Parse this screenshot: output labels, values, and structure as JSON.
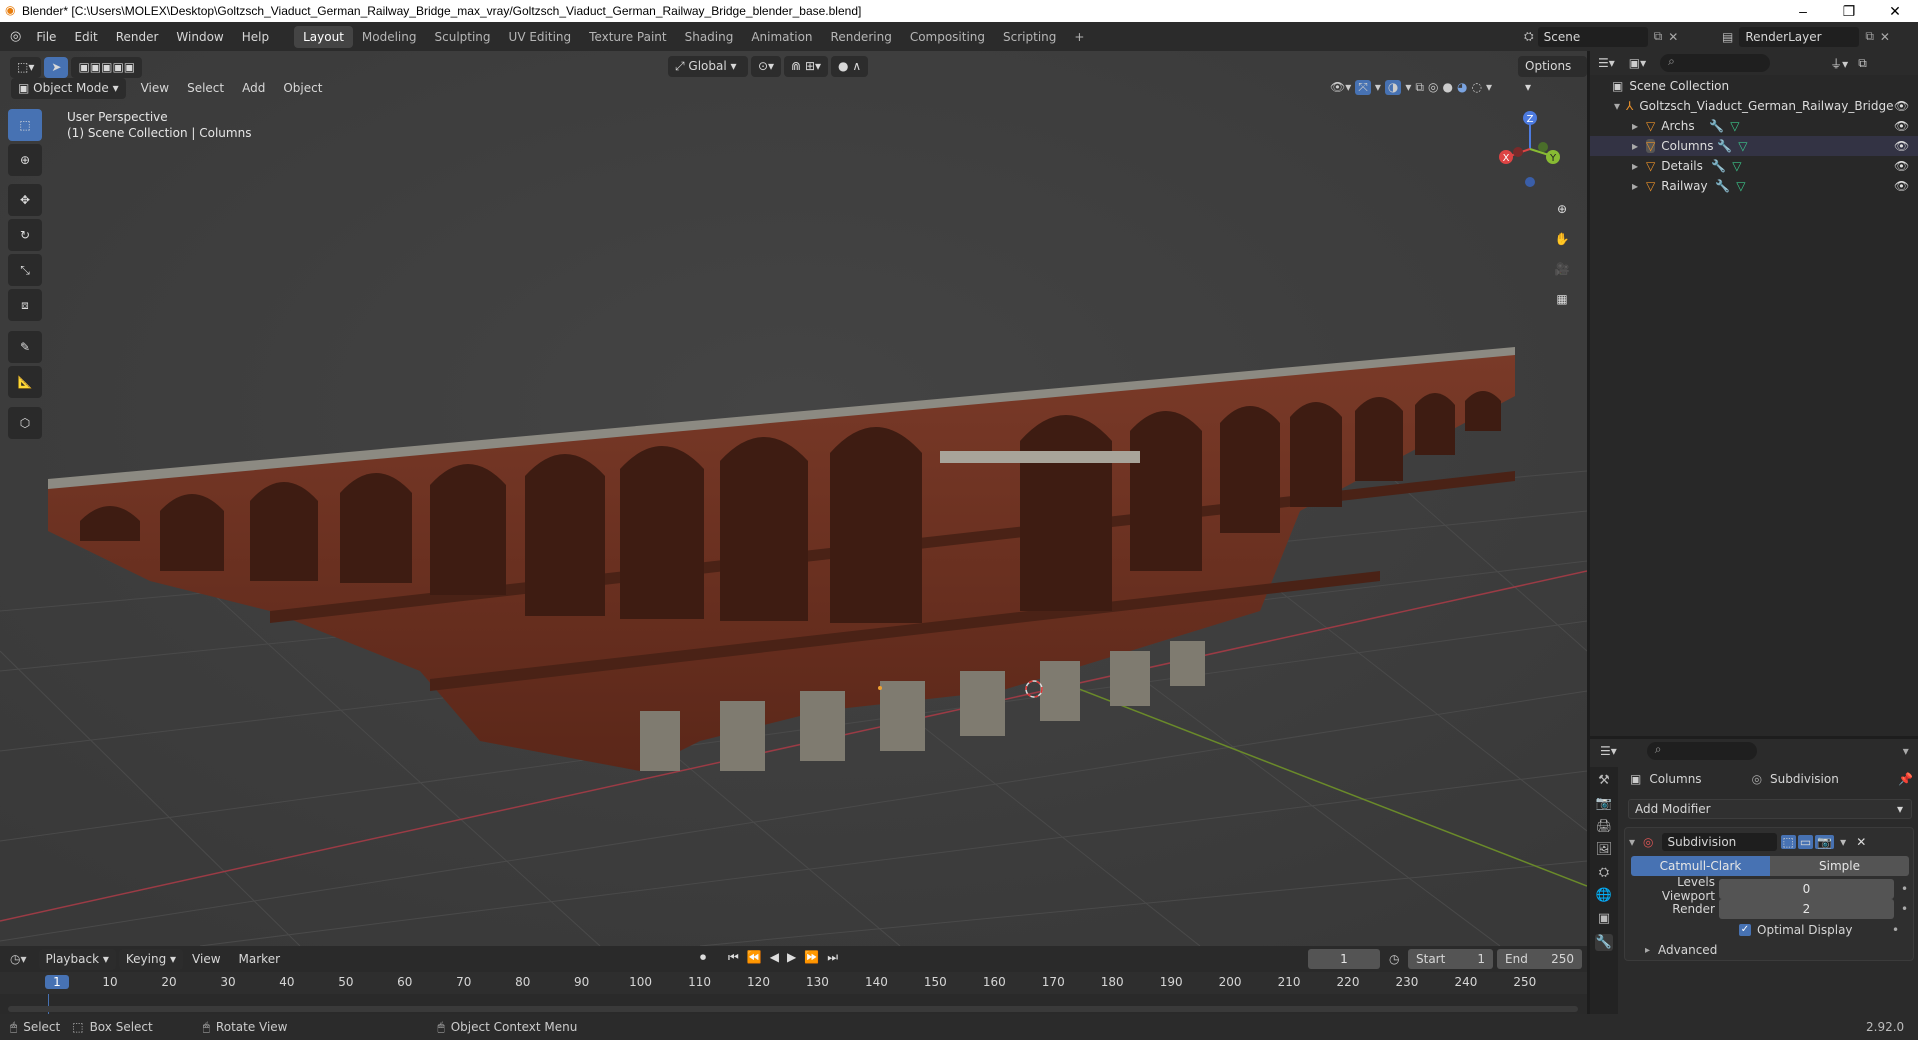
{
  "window": {
    "title": "Blender* [C:\\Users\\MOLEX\\Desktop\\Goltzsch_Viaduct_German_Railway_Bridge_max_vray/Goltzsch_Viaduct_German_Railway_Bridge_blender_base.blend]",
    "minimize": "–",
    "maximize": "❐",
    "close": "✕"
  },
  "menu": [
    "File",
    "Edit",
    "Render",
    "Window",
    "Help"
  ],
  "workspaces": [
    "Layout",
    "Modeling",
    "Sculpting",
    "UV Editing",
    "Texture Paint",
    "Shading",
    "Animation",
    "Rendering",
    "Compositing",
    "Scripting",
    "+"
  ],
  "scene": {
    "name": "Scene",
    "render_layer": "RenderLayer"
  },
  "viewport": {
    "mode": "Object Mode",
    "menus": [
      "View",
      "Select",
      "Add",
      "Object"
    ],
    "transform": "Global",
    "options": "Options",
    "perspective": "User Perspective",
    "collection_info": "(1) Scene Collection | Columns",
    "gizmo": {
      "z": "Z",
      "x": "X",
      "y": "Y"
    }
  },
  "outliner": {
    "root": "Scene Collection",
    "collection": "Goltzsch_Viaduct_German_Railway_Bridge",
    "objects": [
      "Archs",
      "Columns",
      "Details",
      "Railway"
    ]
  },
  "properties": {
    "object": "Columns",
    "modifier_tab": "Subdivision",
    "add_modifier": "Add Modifier",
    "modifier_name": "Subdivision",
    "method_a": "Catmull-Clark",
    "method_b": "Simple",
    "levels_viewport_label": "Levels Viewport",
    "levels_viewport": "0",
    "render_label": "Render",
    "render": "2",
    "optimal_display": "Optimal Display",
    "advanced": "Advanced"
  },
  "timeline": {
    "menus": [
      "Playback",
      "Keying",
      "View",
      "Marker"
    ],
    "current_frame": "1",
    "start_label": "Start",
    "start": "1",
    "end_label": "End",
    "end": "250",
    "ticks": [
      "1",
      "10",
      "20",
      "30",
      "40",
      "50",
      "60",
      "70",
      "80",
      "90",
      "100",
      "110",
      "120",
      "130",
      "140",
      "150",
      "160",
      "170",
      "180",
      "190",
      "200",
      "210",
      "220",
      "230",
      "240",
      "250"
    ]
  },
  "status": {
    "select": "Select",
    "box_select": "Box Select",
    "rotate": "Rotate View",
    "context": "Object Context Menu",
    "version": "2.92.0"
  }
}
